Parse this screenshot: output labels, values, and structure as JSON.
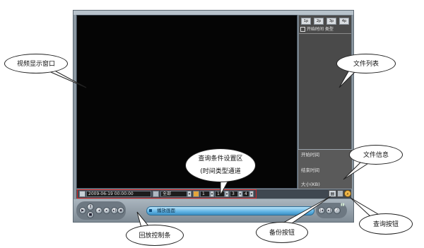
{
  "query_bar": {
    "datetime": "2009-06-19 00:00:00",
    "type_value": "全部",
    "channel_values": [
      "1",
      "1",
      "3",
      "4"
    ]
  },
  "right_panel": {
    "tabs": [
      "1p",
      "2p",
      "3p",
      "4p"
    ],
    "column_header": "开始时间 类型",
    "info_labels": [
      "开始时间",
      "结束时间",
      "大小(KB)"
    ]
  },
  "playback": {
    "progress_label": "播放画面"
  },
  "callouts": {
    "video_window": "视频显示窗口",
    "file_list": "文件列表",
    "query_conditions_line1": "查询条件设置区",
    "query_conditions_line2": "(时间类型通道",
    "file_info": "文件信息",
    "playback_controls": "回放控制条",
    "backup_button": "备份按钮",
    "query_button": "查询按钮"
  },
  "colors": {
    "highlight_border": "#d22222",
    "progress_fill": "#5fb3e4",
    "query_button": "#f0b84a"
  },
  "icons": [
    "search-icon",
    "calendar-icon",
    "play-icon",
    "stop-icon",
    "backup-icon",
    "query-icon"
  ]
}
